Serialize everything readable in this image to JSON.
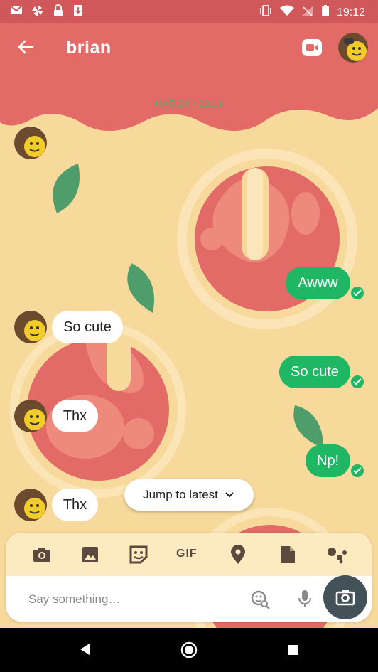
{
  "status_bar": {
    "left_icons": [
      "gmail-icon",
      "pinwheel-icon",
      "lock-icon",
      "download-icon"
    ],
    "right_icons": [
      "vibrate-icon",
      "wifi-icon",
      "no-signal-icon",
      "battery-icon"
    ],
    "time": "19:12"
  },
  "header": {
    "title": "brian",
    "back_icon": "arrow-left-icon",
    "video_icon": "video-call-icon"
  },
  "date_label": "MAR 26 • 23:19",
  "messages": [
    {
      "direction": "outgoing",
      "text": "Awww",
      "status": "read"
    },
    {
      "direction": "incoming",
      "text": "So cute"
    },
    {
      "direction": "outgoing",
      "text": "So cute",
      "status": "read"
    },
    {
      "direction": "incoming",
      "text": "Thx"
    },
    {
      "direction": "outgoing",
      "text": "Np!",
      "status": "read"
    },
    {
      "direction": "incoming",
      "text": "Thx"
    }
  ],
  "jump_to_latest": "Jump to latest",
  "toolbar": {
    "icons": [
      "camera-icon",
      "image-icon",
      "sticker-icon",
      "gif-icon",
      "location-icon",
      "document-icon",
      "assistant-icon"
    ],
    "gif_label": "GIF"
  },
  "compose": {
    "placeholder": "Say something…",
    "value": ""
  },
  "nav": [
    "back-icon",
    "home-icon",
    "recents-icon"
  ],
  "colors": {
    "header": "#e26a67",
    "background": "#f7d99c",
    "outgoing_bubble": "#1fb664",
    "incoming_bubble": "#ffffff",
    "fab": "#435158"
  }
}
